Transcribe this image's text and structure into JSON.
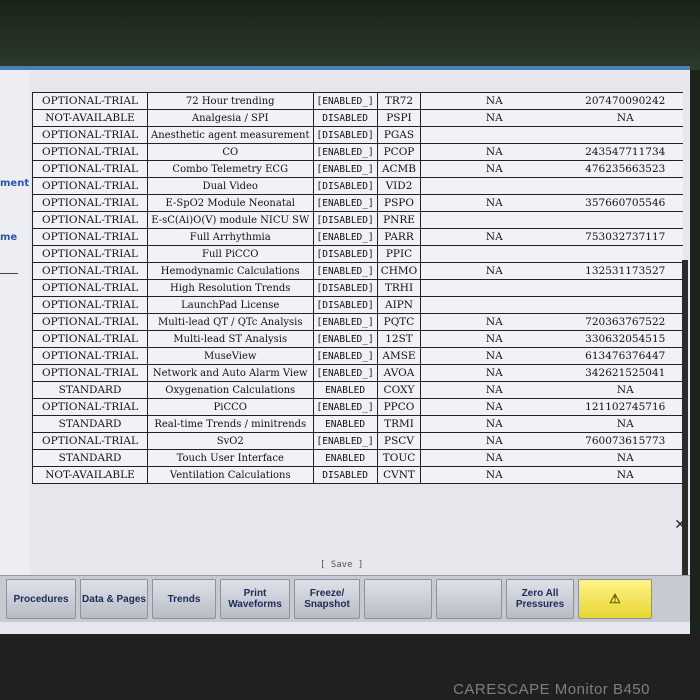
{
  "sidebar": {
    "labels": [
      "ment",
      "me"
    ]
  },
  "table": {
    "rows": [
      {
        "license": "OPTIONAL-TRIAL",
        "feature": "72 Hour trending",
        "status": "[ENABLED_]",
        "code": "TR72",
        "support": "NA",
        "key": "207470090242"
      },
      {
        "license": "NOT-AVAILABLE",
        "feature": "Analgesia / SPI",
        "status": "DISABLED",
        "code": "PSPI",
        "support": "NA",
        "key": "NA"
      },
      {
        "license": "OPTIONAL-TRIAL",
        "feature": "Anesthetic agent measurement",
        "status": "[DISABLED]",
        "code": "PGAS",
        "support": "",
        "key": ""
      },
      {
        "license": "OPTIONAL-TRIAL",
        "feature": "CO",
        "status": "[ENABLED_]",
        "code": "PCOP",
        "support": "NA",
        "key": "243547711734"
      },
      {
        "license": "OPTIONAL-TRIAL",
        "feature": "Combo Telemetry ECG",
        "status": "[ENABLED_]",
        "code": "ACMB",
        "support": "NA",
        "key": "476235663523"
      },
      {
        "license": "OPTIONAL-TRIAL",
        "feature": "Dual Video",
        "status": "[DISABLED]",
        "code": "VID2",
        "support": "",
        "key": ""
      },
      {
        "license": "OPTIONAL-TRIAL",
        "feature": "E-SpO2 Module Neonatal",
        "status": "[ENABLED_]",
        "code": "PSPO",
        "support": "NA",
        "key": "357660705546"
      },
      {
        "license": "OPTIONAL-TRIAL",
        "feature": "E-sC(Ai)O(V) module NICU SW",
        "status": "[DISABLED]",
        "code": "PNRE",
        "support": "",
        "key": ""
      },
      {
        "license": "OPTIONAL-TRIAL",
        "feature": "Full Arrhythmia",
        "status": "[ENABLED_]",
        "code": "PARR",
        "support": "NA",
        "key": "753032737117"
      },
      {
        "license": "OPTIONAL-TRIAL",
        "feature": "Full PiCCO",
        "status": "[DISABLED]",
        "code": "PPIC",
        "support": "",
        "key": ""
      },
      {
        "license": "OPTIONAL-TRIAL",
        "feature": "Hemodynamic Calculations",
        "status": "[ENABLED_]",
        "code": "CHMO",
        "support": "NA",
        "key": "132531173527"
      },
      {
        "license": "OPTIONAL-TRIAL",
        "feature": "High Resolution Trends",
        "status": "[DISABLED]",
        "code": "TRHI",
        "support": "",
        "key": ""
      },
      {
        "license": "OPTIONAL-TRIAL",
        "feature": "LaunchPad License",
        "status": "[DISABLED]",
        "code": "AIPN",
        "support": "",
        "key": ""
      },
      {
        "license": "OPTIONAL-TRIAL",
        "feature": "Multi-lead QT / QTc Analysis",
        "status": "[ENABLED_]",
        "code": "PQTC",
        "support": "NA",
        "key": "720363767522"
      },
      {
        "license": "OPTIONAL-TRIAL",
        "feature": "Multi-lead ST Analysis",
        "status": "[ENABLED_]",
        "code": "12ST",
        "support": "NA",
        "key": "330632054515"
      },
      {
        "license": "OPTIONAL-TRIAL",
        "feature": "MuseView",
        "status": "[ENABLED_]",
        "code": "AMSE",
        "support": "NA",
        "key": "613476376447"
      },
      {
        "license": "OPTIONAL-TRIAL",
        "feature": "Network and Auto Alarm View",
        "status": "[ENABLED_]",
        "code": "AVOA",
        "support": "NA",
        "key": "342621525041"
      },
      {
        "license": "STANDARD",
        "feature": "Oxygenation Calculations",
        "status": "ENABLED",
        "code": "COXY",
        "support": "NA",
        "key": "NA"
      },
      {
        "license": "OPTIONAL-TRIAL",
        "feature": "PiCCO",
        "status": "[ENABLED_]",
        "code": "PPCO",
        "support": "NA",
        "key": "121102745716"
      },
      {
        "license": "STANDARD",
        "feature": "Real-time Trends / minitrends",
        "status": "ENABLED",
        "code": "TRMI",
        "support": "NA",
        "key": "NA"
      },
      {
        "license": "OPTIONAL-TRIAL",
        "feature": "SvO2",
        "status": "[ENABLED_]",
        "code": "PSCV",
        "support": "NA",
        "key": "760073615773"
      },
      {
        "license": "STANDARD",
        "feature": "Touch User Interface",
        "status": "ENABLED",
        "code": "TOUC",
        "support": "NA",
        "key": "NA"
      },
      {
        "license": "NOT-AVAILABLE",
        "feature": "Ventilation Calculations",
        "status": "DISABLED",
        "code": "CVNT",
        "support": "NA",
        "key": "NA"
      }
    ]
  },
  "save_label": "[ Save ]",
  "toolbar": {
    "buttons": [
      {
        "label": "Procedures",
        "enabled": true
      },
      {
        "label": "Data & Pages",
        "enabled": true
      },
      {
        "label": "Trends",
        "enabled": true
      },
      {
        "label": "Print Waveforms",
        "enabled": true
      },
      {
        "label": "Freeze/ Snapshot",
        "enabled": true
      },
      {
        "label": "",
        "enabled": false
      },
      {
        "label": "",
        "enabled": false
      },
      {
        "label": "Zero All Pressures",
        "enabled": true
      },
      {
        "label": "⚠",
        "enabled": true
      }
    ]
  },
  "brand": "CARESCAPE Monitor B450",
  "colors": {
    "screen_bg": "#e6e6ec",
    "sidebar_text": "#2a54b0",
    "alarm_button": "#f0e24a"
  }
}
